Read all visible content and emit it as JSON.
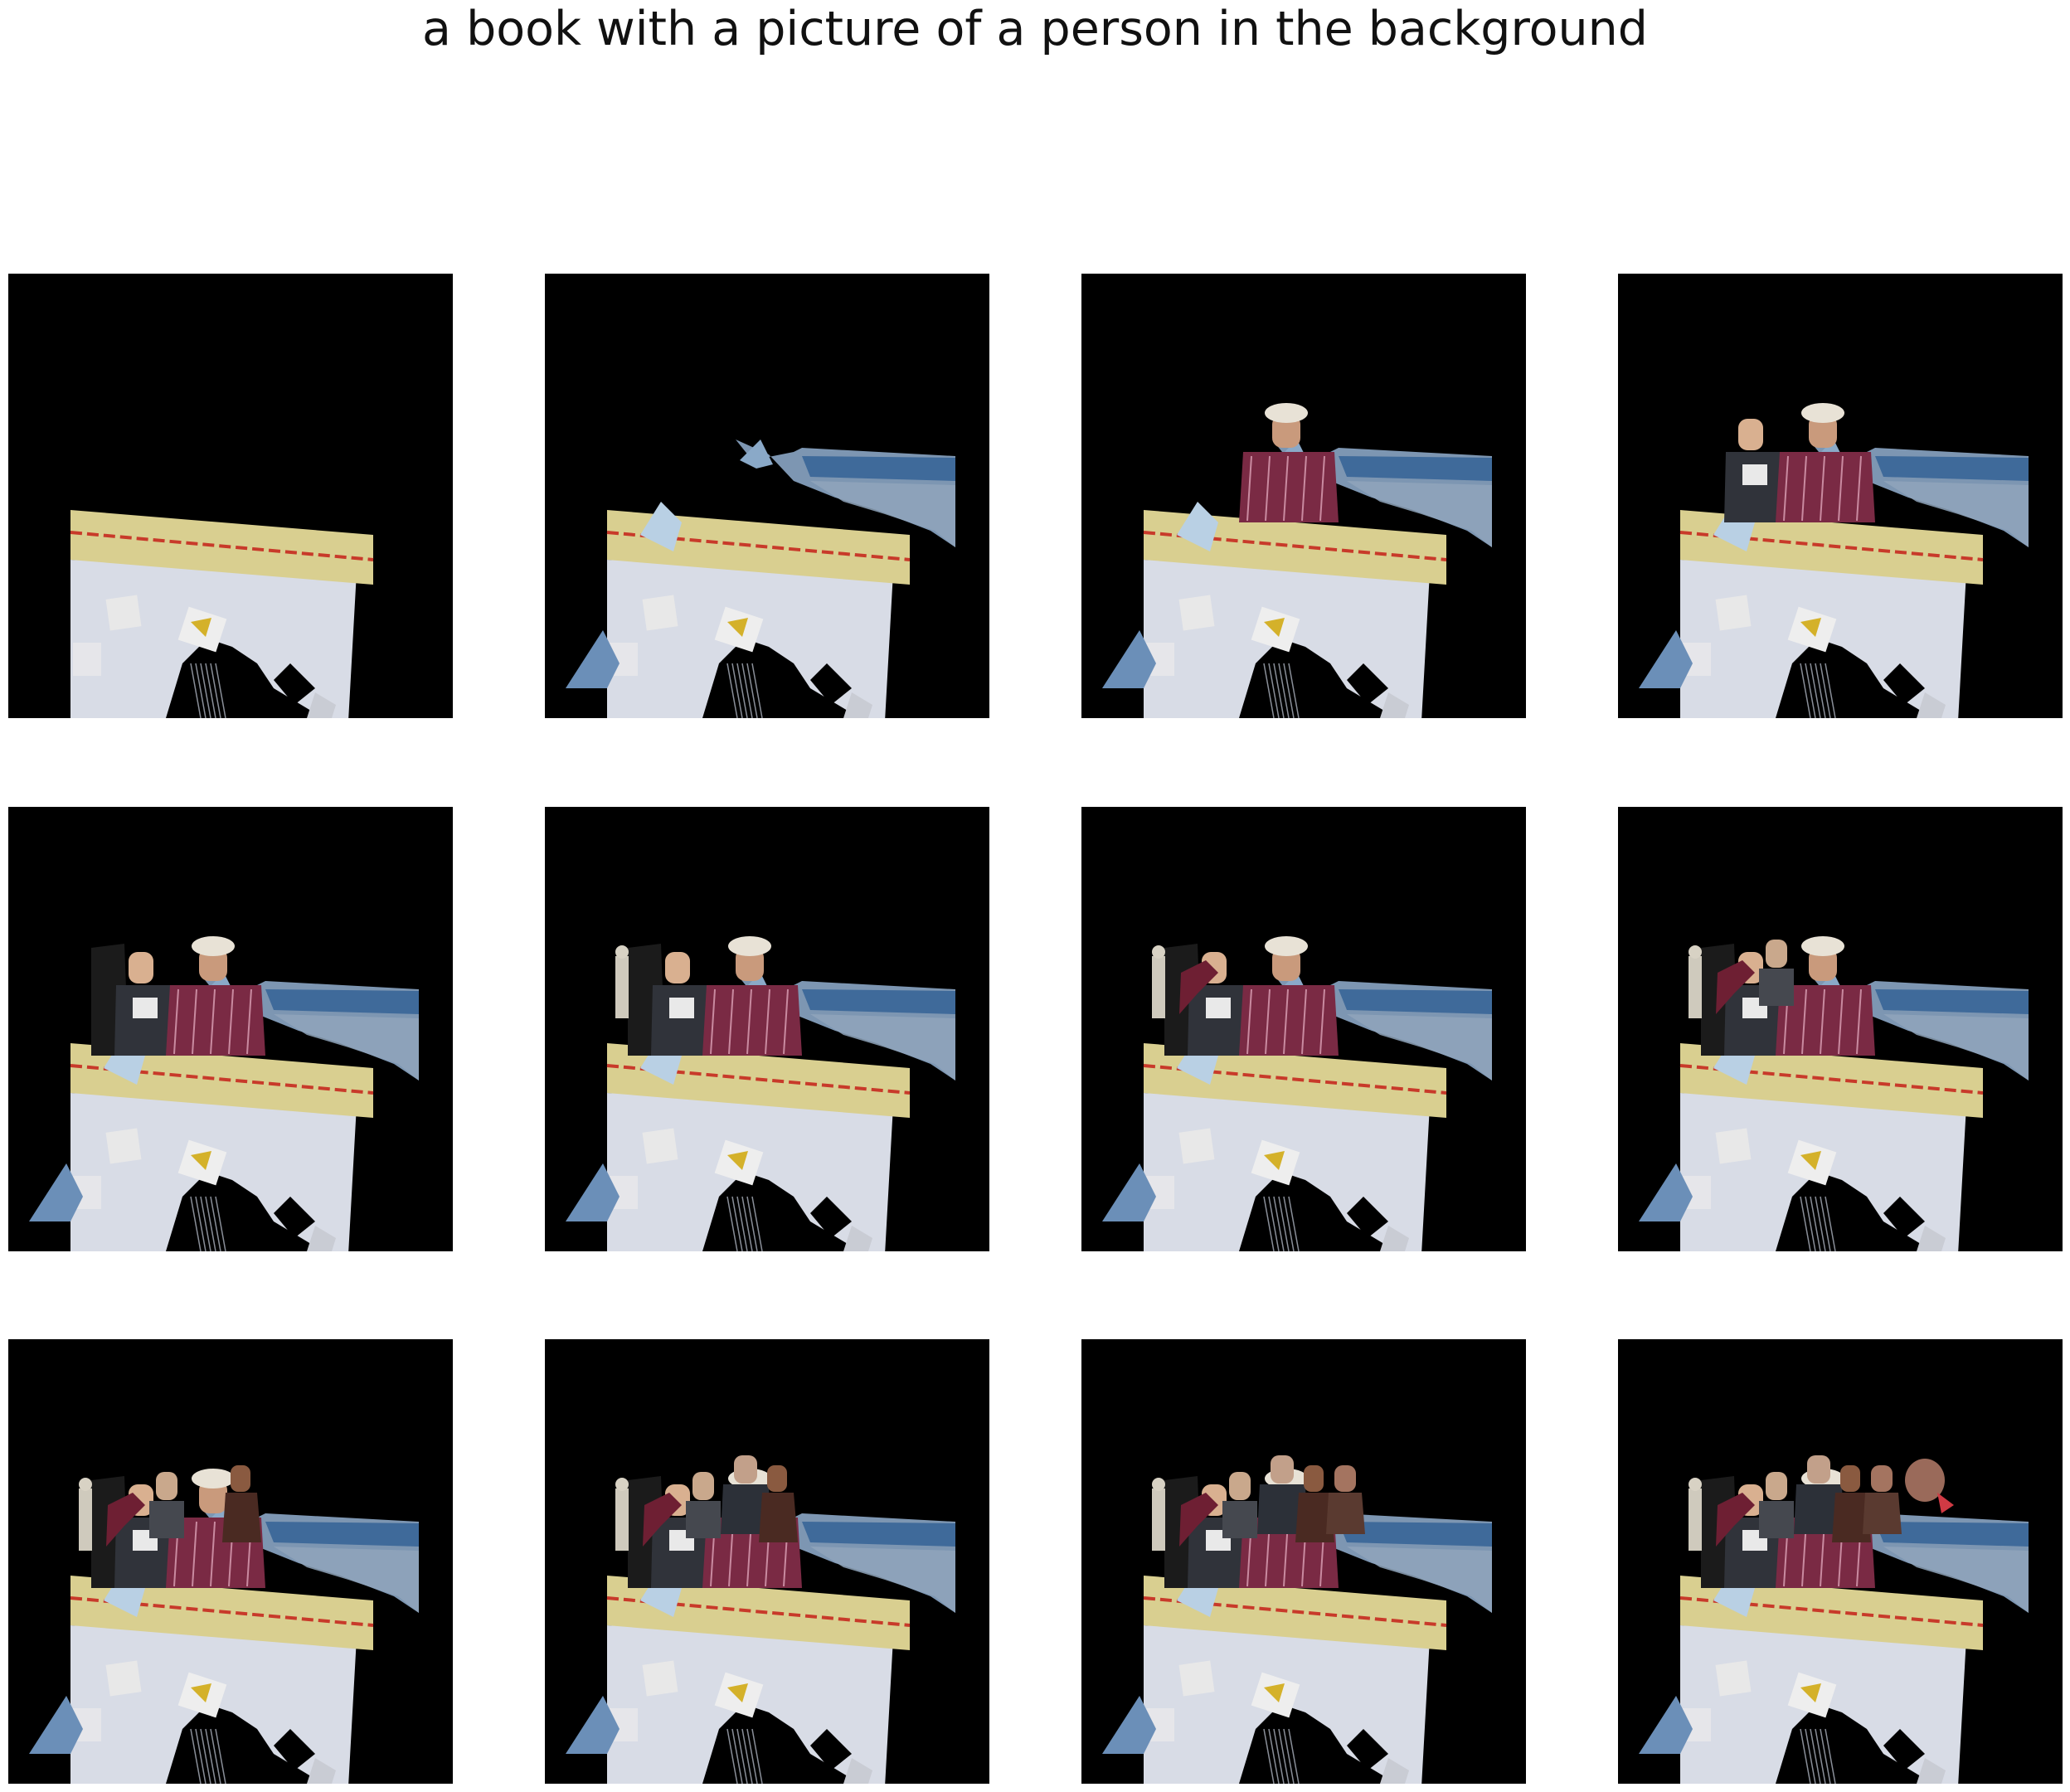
{
  "title": "a book with a picture of a person in the background",
  "grid": {
    "rows": 3,
    "cols": 4,
    "panels": [
      {
        "step": 1,
        "layers": [
          "book"
        ]
      },
      {
        "step": 2,
        "layers": [
          "book",
          "water",
          "cloth"
        ]
      },
      {
        "step": 3,
        "layers": [
          "book",
          "water",
          "cloth",
          "person-1"
        ]
      },
      {
        "step": 4,
        "layers": [
          "book",
          "water",
          "cloth",
          "person-1",
          "person-2"
        ]
      },
      {
        "step": 5,
        "layers": [
          "book",
          "water",
          "cloth",
          "person-1",
          "person-2",
          "dark-figure"
        ]
      },
      {
        "step": 6,
        "layers": [
          "book",
          "water",
          "cloth",
          "person-1",
          "person-2",
          "dark-figure",
          "statue"
        ]
      },
      {
        "step": 7,
        "layers": [
          "book",
          "water",
          "cloth",
          "person-1",
          "person-2",
          "dark-figure",
          "statue",
          "arm"
        ]
      },
      {
        "step": 8,
        "layers": [
          "book",
          "water",
          "cloth",
          "person-1",
          "person-2",
          "dark-figure",
          "statue",
          "arm",
          "person-3"
        ]
      },
      {
        "step": 9,
        "layers": [
          "book",
          "water",
          "cloth",
          "person-1",
          "person-2",
          "dark-figure",
          "statue",
          "arm",
          "person-3",
          "person-4"
        ]
      },
      {
        "step": 10,
        "layers": [
          "book",
          "water",
          "cloth",
          "person-1",
          "person-2",
          "dark-figure",
          "statue",
          "arm",
          "person-3",
          "person-4",
          "person-5"
        ]
      },
      {
        "step": 11,
        "layers": [
          "book",
          "water",
          "cloth",
          "person-1",
          "person-2",
          "dark-figure",
          "statue",
          "arm",
          "person-3",
          "person-4",
          "person-5",
          "person-6"
        ]
      },
      {
        "step": 12,
        "layers": [
          "book",
          "water",
          "cloth",
          "person-1",
          "person-2",
          "dark-figure",
          "statue",
          "arm",
          "person-3",
          "person-4",
          "person-5",
          "person-6",
          "face-blur"
        ]
      }
    ]
  },
  "colors": {
    "background": "#ffffff",
    "panel": "#000000",
    "page": "#d8dce6",
    "band": "#d9cf90",
    "stripe": "#c83a2a",
    "water": "#7d96b2",
    "shirt": "#7a2a44",
    "skin": "#c99a7c",
    "hat": "#e8e2d6"
  }
}
